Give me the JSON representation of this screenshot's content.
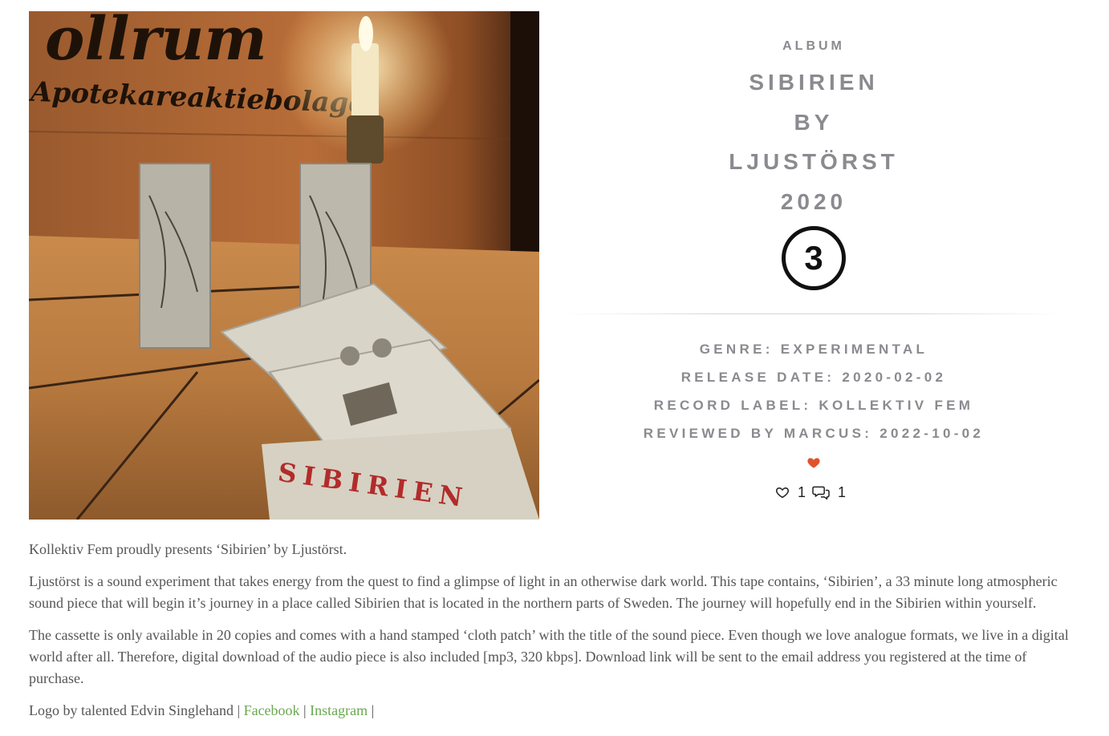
{
  "review": {
    "type_label": "ALBUM",
    "title_lines": [
      "SIBIRIEN",
      "BY",
      "LJUSTÖRST",
      "2020"
    ],
    "rating": "3",
    "meta": [
      "GENRE: EXPERIMENTAL",
      "RELEASE DATE: 2020-02-02",
      "RECORD LABEL: KOLLEKTIV FEM",
      "REVIEWED BY MARCUS: 2022-10-02"
    ],
    "likes": "1",
    "comments": "1"
  },
  "cover": {
    "crate_text_top": "ollrum",
    "crate_text": "Apotekareaktiebolaget",
    "patch_text": "SIBIRIEN"
  },
  "description": {
    "p1": "Kollektiv Fem proudly presents ‘Sibirien’ by Ljustörst.",
    "p2": "Ljustörst is a sound experiment that takes energy from the quest to find a glimpse of light in an otherwise dark world. This tape contains, ‘Sibirien’, a 33 minute long atmospheric sound piece that will begin it’s journey in a place called Sibirien that is located in the northern parts of Sweden. The journey will hopefully end in the Sibirien within yourself.",
    "p3": "The cassette is only available in 20 copies and comes with a hand stamped ‘cloth patch’ with the title of the sound piece. Even though we love analogue formats, we live in a digital world after all. Therefore, digital download of the audio piece is also included [mp3, 320 kbps]. Download link will be sent to the email address you registered at the time of purchase.",
    "credits_prefix": "Logo by talented Edvin Singlehand | ",
    "separator": " | ",
    "facebook_label": "Facebook",
    "instagram_label": "Instagram",
    "credits_suffix": " |"
  },
  "colors": {
    "heading": "#8a8a8f",
    "accent_heart": "#e0522c",
    "link": "#6aa84f",
    "body_text": "#555555"
  },
  "icons": {
    "like": "heart-outline-icon",
    "comment": "comment-bubbles-icon",
    "favorite": "heart-filled-icon"
  }
}
